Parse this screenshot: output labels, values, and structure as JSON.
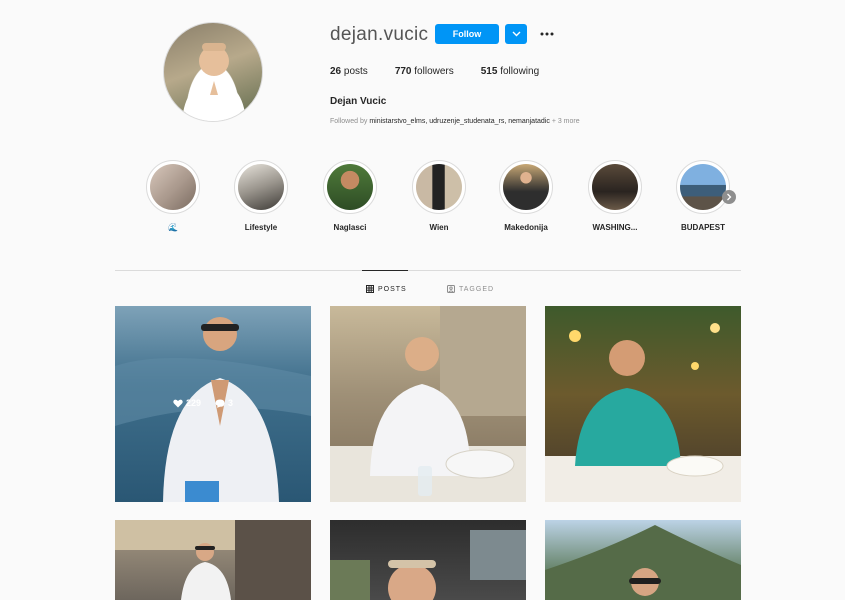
{
  "profile": {
    "username": "dejan.vucic",
    "follow_label": "Follow",
    "full_name": "Dejan Vucic",
    "followed_by_prefix": "Followed by",
    "followed_by_names": "ministarstvo_elms, udruzenje_studenata_rs, nemanjatadic",
    "followed_by_more": "+ 3 more",
    "stats": {
      "posts_count": "26",
      "posts_label": "posts",
      "followers_count": "770",
      "followers_label": "followers",
      "following_count": "515",
      "following_label": "following"
    }
  },
  "highlights": [
    {
      "label": "🌊"
    },
    {
      "label": "Lifestyle"
    },
    {
      "label": "Naglasci"
    },
    {
      "label": "Wien"
    },
    {
      "label": "Makedonija"
    },
    {
      "label": "WASHING..."
    },
    {
      "label": "BUDAPEST"
    }
  ],
  "tabs": {
    "posts": "POSTS",
    "tagged": "TAGGED"
  },
  "posts": [
    {
      "likes": "229",
      "comments": "3"
    }
  ],
  "icons": [
    "chevron-down-icon",
    "more-icon",
    "grid-icon",
    "tagged-icon",
    "heart-icon",
    "comment-icon",
    "chevron-right-icon"
  ],
  "colors": {
    "accent": "#0095f6"
  }
}
